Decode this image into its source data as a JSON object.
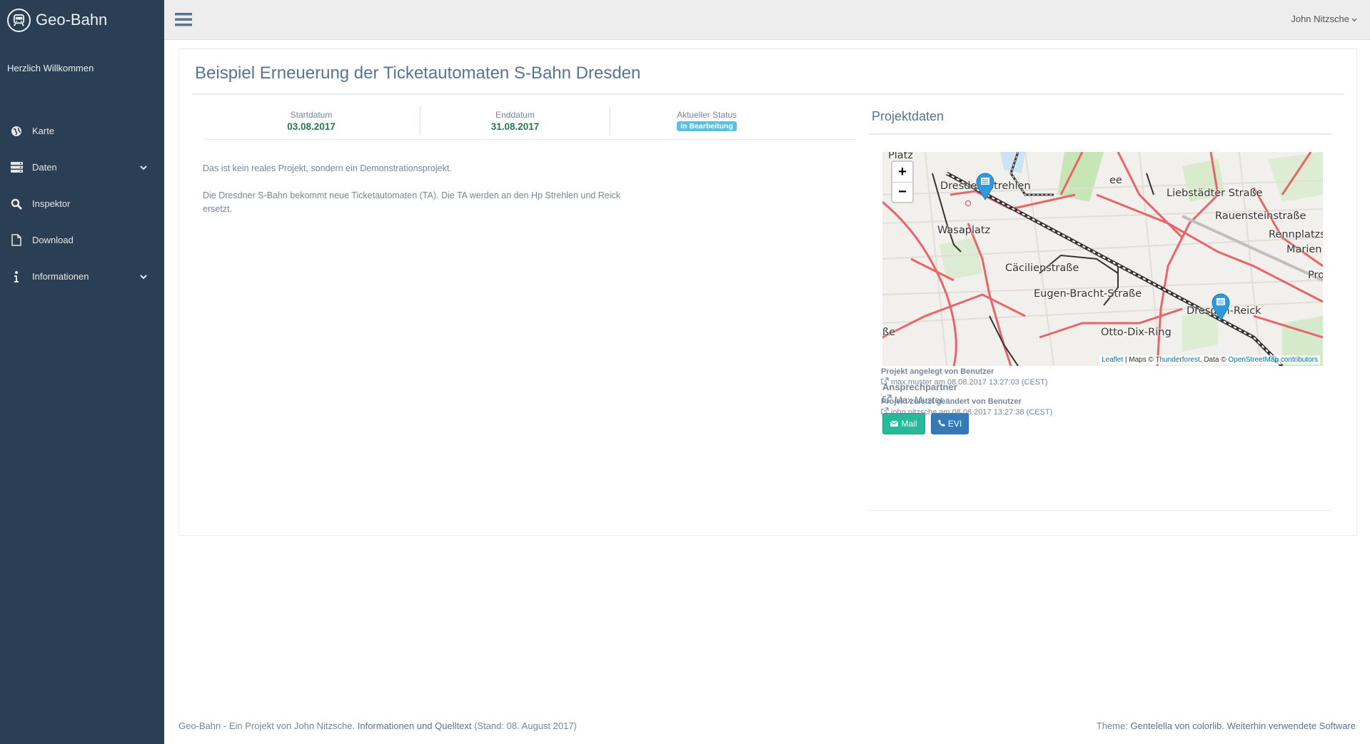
{
  "app": {
    "title": "Geo-Bahn",
    "welcome": "Herzlich Willkommen"
  },
  "sidebar": {
    "items": [
      {
        "label": "Karte",
        "icon": "globe-icon"
      },
      {
        "label": "Daten",
        "icon": "database-icon",
        "has_submenu": true
      },
      {
        "label": "Inspektor",
        "icon": "search-icon"
      },
      {
        "label": "Download",
        "icon": "file-icon"
      },
      {
        "label": "Informationen",
        "icon": "info-icon",
        "has_submenu": true
      }
    ]
  },
  "topbar": {
    "user": "John Nitzsche"
  },
  "project": {
    "title": "Beispiel Erneuerung der Ticketautomaten S-Bahn Dresden",
    "stats": {
      "start_label": "Startdatum",
      "start_value": "03.08.2017",
      "end_label": "Enddatum",
      "end_value": "31.08.2017",
      "status_label": "Aktueller Status",
      "status_value": "in Bearbeitung"
    },
    "description": [
      "Das ist kein reales Projekt, sondern ein Demonstrationsprojekt.",
      "Die Dresdner S-Bahn bekommt neue Ticketautomaten (TA). Die TA werden an den Hp Strehlen und Reick ersetzt."
    ],
    "data_title": "Projektdaten",
    "map": {
      "zoom_in": "+",
      "zoom_out": "−",
      "labels": {
        "platz": "Platz",
        "strehlen": "Dresden-Strehlen",
        "ee": "ee",
        "liebstaedter": "Liebstädter Straße",
        "rauenstein": "Rauensteinstraße",
        "rennplatz": "Rennplatzs",
        "marien": "Marien",
        "wasaplatz": "Wasaplatz",
        "caecilien": "Cäcilienstraße",
        "eugen": "Eugen-Bracht-Straße",
        "pro": "Pro",
        "reick": "Dresden-Reick",
        "otto": "Otto-Dix-Ring",
        "sse": "ße"
      },
      "attribution": {
        "leaflet": "Leaflet",
        "maps_text": " | Maps © ",
        "thunderforest": "Thunderforest",
        "data_text": ", Data © ",
        "osm": "OpenStreetMap contributors"
      }
    },
    "contact_label": "Ansprechpartner",
    "contact_name": "Max Muster",
    "buttons": {
      "mail": "Mail",
      "evi": "EVI"
    },
    "created_label": "Projekt angelegt von Benutzer",
    "created_value": "max.muster am 08.08.2017 13:27:03 (CEST)",
    "modified_label": "Projekt zuletzt geändert von Benutzer",
    "modified_value": "john.nitzsche am 08.08.2017 13:27:38 (CEST)"
  },
  "footer": {
    "left_text": "Geo-Bahn - Ein Projekt von John Nitzsche. ",
    "left_link": "Informationen und Quelltext",
    "left_suffix": " (Stand: 08. August 2017)",
    "right_text": "Theme: ",
    "right_link1": "Gentelella von colorlib",
    "right_sep": ". ",
    "right_link2": "Weiterhin verwendete Software"
  },
  "colors": {
    "sidebar": "#2A3F54",
    "topbar": "#EDEDED",
    "mail_button": "#26B99A",
    "evi_button": "#337AB7",
    "status_badge": "#5BC0DE",
    "date_value": "#26774B"
  }
}
